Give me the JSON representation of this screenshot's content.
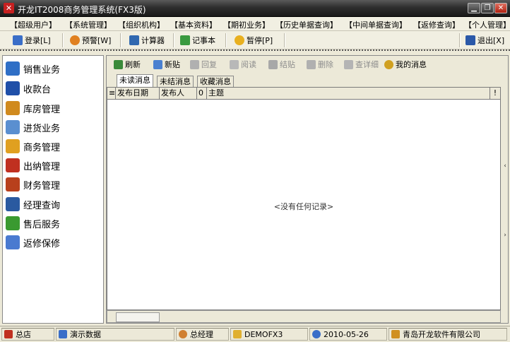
{
  "window": {
    "title": "开龙IT2008商务管理系统(FX3版)",
    "controls": {
      "minimize": "▁",
      "restore": "❐",
      "close": "✕"
    }
  },
  "menu": [
    {
      "label": "【超级用户】"
    },
    {
      "label": "【系统管理】"
    },
    {
      "label": "【组织机构】"
    },
    {
      "label": "【基本资料】"
    },
    {
      "label": "【期初业务】"
    },
    {
      "label": "【历史单据查询】"
    },
    {
      "label": "【中间单据查询】"
    },
    {
      "label": "【返修查询】"
    },
    {
      "label": "【个人管理】"
    }
  ],
  "toolbar": {
    "login": "登录[L]",
    "alert": "预警[W]",
    "calculator": "计算器",
    "notepad": "记事本",
    "pause": "暂停[P]",
    "exit": "退出[X]"
  },
  "sidebar": {
    "items": [
      {
        "label": "销售业务",
        "icon": "sales-icon",
        "color": "#2f6fc6"
      },
      {
        "label": "收款台",
        "icon": "cashier-icon",
        "color": "#1f4fa8"
      },
      {
        "label": "库房管理",
        "icon": "warehouse-icon",
        "color": "#d08a1e"
      },
      {
        "label": "进货业务",
        "icon": "purchase-icon",
        "color": "#5a8fd0"
      },
      {
        "label": "商务管理",
        "icon": "business-icon",
        "color": "#e0a020"
      },
      {
        "label": "出纳管理",
        "icon": "teller-icon",
        "color": "#c03020"
      },
      {
        "label": "财务管理",
        "icon": "finance-icon",
        "color": "#b8401c"
      },
      {
        "label": "经理查询",
        "icon": "manager-query-icon",
        "color": "#2a5aa0"
      },
      {
        "label": "售后服务",
        "icon": "after-sales-icon",
        "color": "#3a9a30"
      },
      {
        "label": "返修保修",
        "icon": "repair-icon",
        "color": "#4a7ad0"
      }
    ]
  },
  "main_toolbar": {
    "refresh": "刷新",
    "new_post": "新贴",
    "reply": "回复",
    "read": "阅读",
    "close_topic": "结贴",
    "delete": "删除",
    "view_detail": "查详细",
    "my_messages": "我的消息"
  },
  "tabs": [
    {
      "label": "未读消息",
      "active": true
    },
    {
      "label": "未结消息",
      "active": false
    },
    {
      "label": "收藏消息",
      "active": false
    }
  ],
  "grid": {
    "columns": [
      "发布日期",
      "发布人",
      "0",
      "主题",
      "!"
    ],
    "empty_message": "<没有任何记录>"
  },
  "statusbar": {
    "branch": "总店",
    "dataset": "演示数据",
    "user": "总经理",
    "database": "DEMOFX3",
    "date": "2010-05-26",
    "company": "青岛开龙软件有限公司"
  }
}
